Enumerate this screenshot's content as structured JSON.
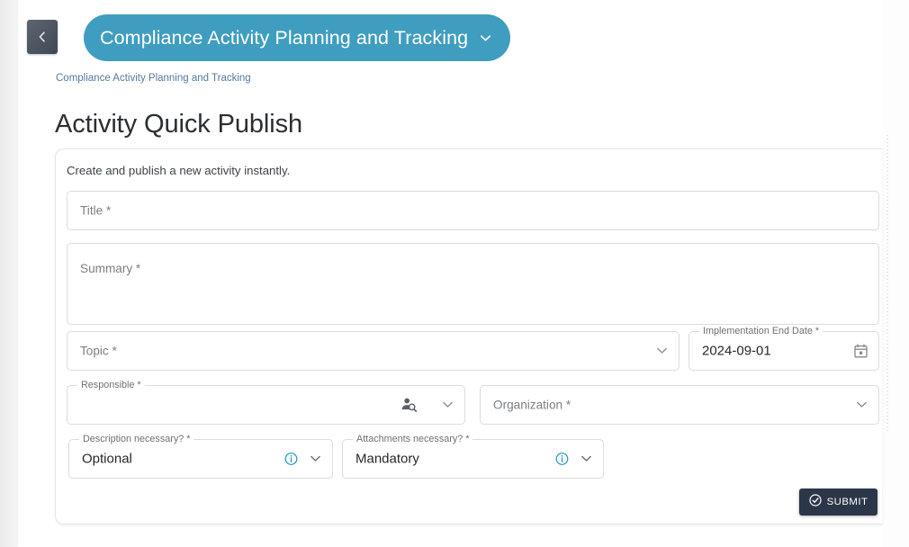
{
  "window": {
    "collapse_button_icon": "chevron-left-icon"
  },
  "header": {
    "module_title": "Compliance Activity Planning and Tracking",
    "module_caret_icon": "chevron-down-icon",
    "breadcrumb": "Compliance Activity Planning and Tracking"
  },
  "page": {
    "title": "Activity Quick Publish",
    "subtitle": "Create and publish a new activity instantly."
  },
  "form": {
    "title_field": {
      "placeholder": "Title *",
      "value": ""
    },
    "summary_field": {
      "placeholder": "Summary *",
      "value": ""
    },
    "topic_field": {
      "placeholder": "Topic *",
      "value": "",
      "caret_icon": "chevron-down-icon"
    },
    "implementation_end_date": {
      "label": "Implementation End Date *",
      "value": "2024-09-01",
      "icon": "calendar-icon"
    },
    "responsible": {
      "label": "Responsible *",
      "value": "",
      "search_icon": "person-search-icon",
      "caret_icon": "chevron-down-icon"
    },
    "organization": {
      "placeholder": "Organization *",
      "value": "",
      "caret_icon": "chevron-down-icon"
    },
    "description_necessary": {
      "label": "Description necessary? *",
      "value": "Optional",
      "info_icon": "info-icon",
      "caret_icon": "chevron-down-icon"
    },
    "attachments_necessary": {
      "label": "Attachments necessary? *",
      "value": "Mandatory",
      "info_icon": "info-icon",
      "caret_icon": "chevron-down-icon"
    }
  },
  "actions": {
    "submit_label": "SUBMIT",
    "submit_icon": "check-circle-icon"
  },
  "colors": {
    "accent_teal": "#3f9dc0",
    "breadcrumb_link": "#55799b",
    "submit_bg": "#2b3648",
    "info_icon": "#2196c4"
  }
}
